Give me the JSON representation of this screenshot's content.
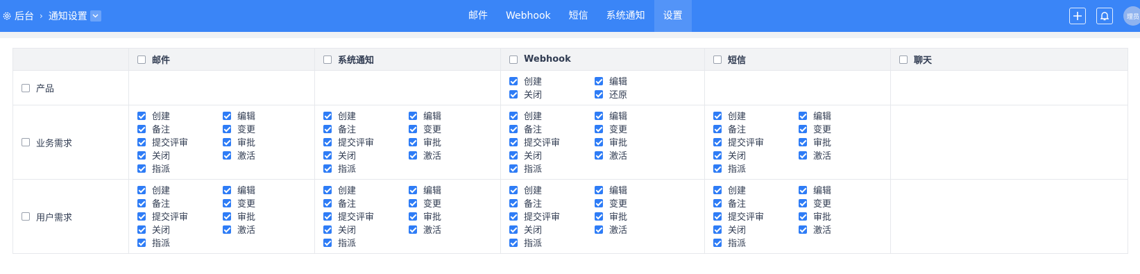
{
  "breadcrumb": {
    "root": "后台",
    "current": "通知设置"
  },
  "nav": {
    "tabs": [
      "邮件",
      "Webhook",
      "短信",
      "系统通知",
      "设置"
    ],
    "active": "设置"
  },
  "user": {
    "avatar_text": "理员"
  },
  "table": {
    "columns": [
      "邮件",
      "系统通知",
      "Webhook",
      "短信",
      "聊天"
    ],
    "rows": [
      {
        "label": "产品",
        "cells": [
          [],
          [],
          [
            "创建",
            "编辑",
            "关闭",
            "还原"
          ],
          [],
          []
        ]
      },
      {
        "label": "业务需求",
        "cells": [
          [
            "创建",
            "编辑",
            "备注",
            "变更",
            "提交评审",
            "审批",
            "关闭",
            "激活",
            "指派"
          ],
          [
            "创建",
            "编辑",
            "备注",
            "变更",
            "提交评审",
            "审批",
            "关闭",
            "激活",
            "指派"
          ],
          [
            "创建",
            "编辑",
            "备注",
            "变更",
            "提交评审",
            "审批",
            "关闭",
            "激活",
            "指派"
          ],
          [
            "创建",
            "编辑",
            "备注",
            "变更",
            "提交评审",
            "审批",
            "关闭",
            "激活",
            "指派"
          ],
          []
        ]
      },
      {
        "label": "用户需求",
        "cells": [
          [
            "创建",
            "编辑",
            "备注",
            "变更",
            "提交评审",
            "审批",
            "关闭",
            "激活",
            "指派"
          ],
          [
            "创建",
            "编辑",
            "备注",
            "变更",
            "提交评审",
            "审批",
            "关闭",
            "激活",
            "指派"
          ],
          [
            "创建",
            "编辑",
            "备注",
            "变更",
            "提交评审",
            "审批",
            "关闭",
            "激活",
            "指派"
          ],
          [
            "创建",
            "编辑",
            "备注",
            "变更",
            "提交评审",
            "审批",
            "关闭",
            "激活",
            "指派"
          ],
          []
        ]
      }
    ]
  },
  "colors": {
    "topbar": "#3a85f7",
    "checkbox_checked": "#2e7cf6"
  },
  "icons": {
    "settings": "gear-icon",
    "dropdown": "chevron-down-icon",
    "add": "plus-icon",
    "notifications": "bell-icon"
  }
}
